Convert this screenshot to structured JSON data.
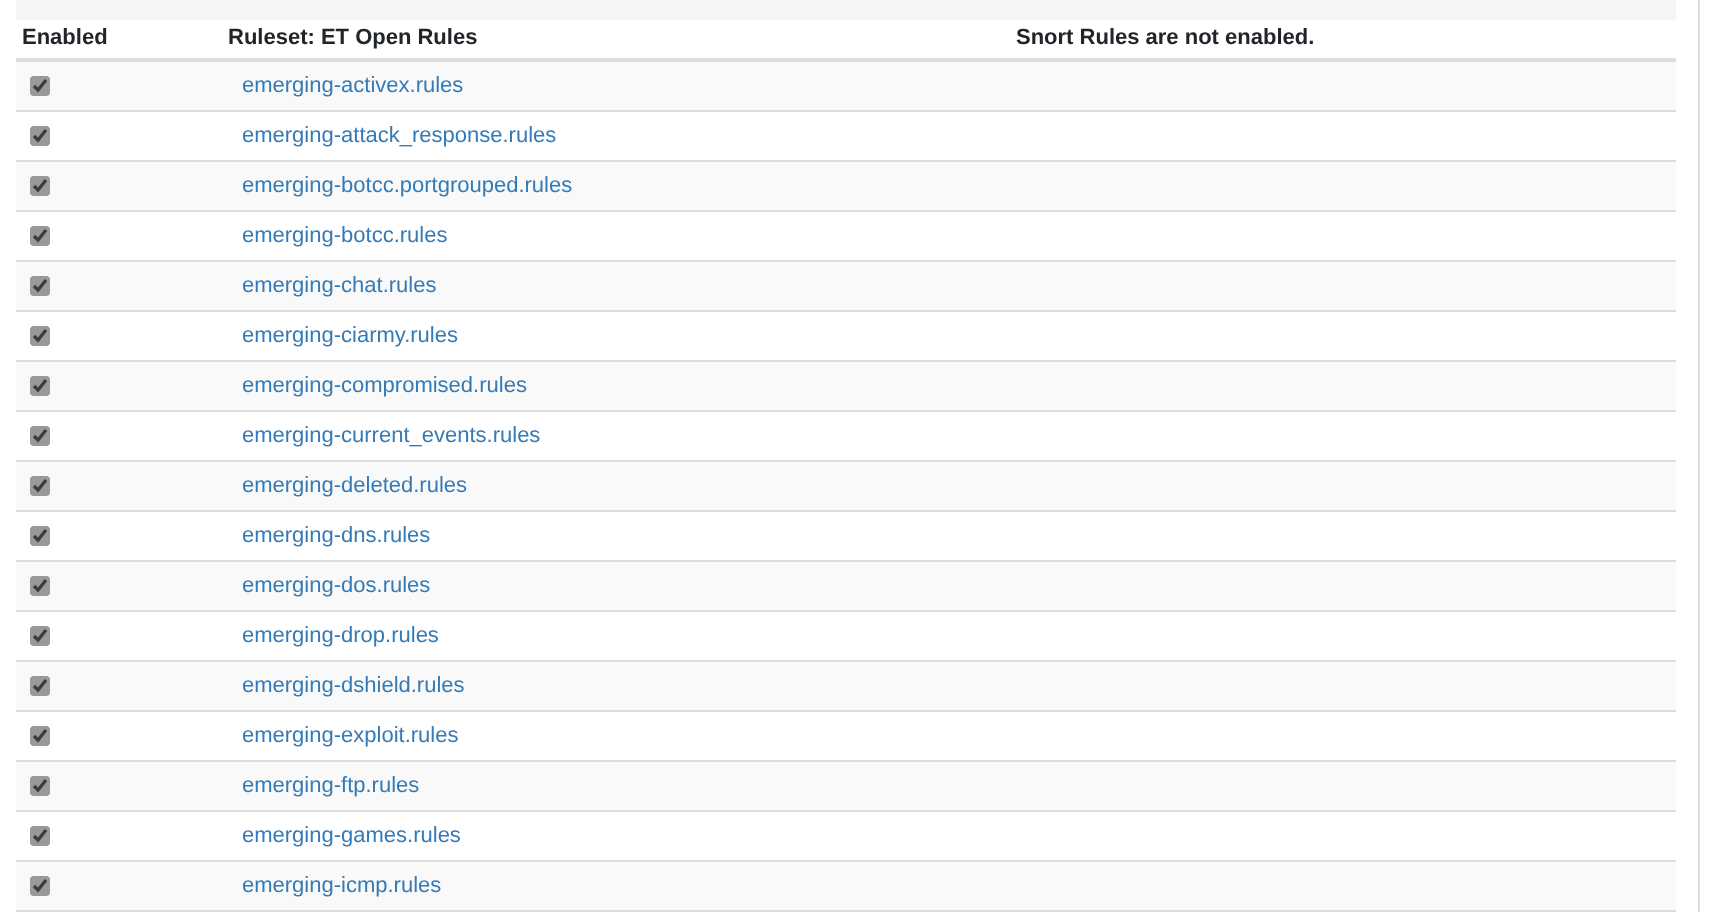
{
  "table": {
    "columns": [
      "Enabled",
      "Ruleset: ET Open Rules",
      "Snort Rules are not enabled."
    ],
    "rows": [
      {
        "checked": true,
        "name": "emerging-activex.rules"
      },
      {
        "checked": true,
        "name": "emerging-attack_response.rules"
      },
      {
        "checked": true,
        "name": "emerging-botcc.portgrouped.rules"
      },
      {
        "checked": true,
        "name": "emerging-botcc.rules"
      },
      {
        "checked": true,
        "name": "emerging-chat.rules"
      },
      {
        "checked": true,
        "name": "emerging-ciarmy.rules"
      },
      {
        "checked": true,
        "name": "emerging-compromised.rules"
      },
      {
        "checked": true,
        "name": "emerging-current_events.rules"
      },
      {
        "checked": true,
        "name": "emerging-deleted.rules"
      },
      {
        "checked": true,
        "name": "emerging-dns.rules"
      },
      {
        "checked": true,
        "name": "emerging-dos.rules"
      },
      {
        "checked": true,
        "name": "emerging-drop.rules"
      },
      {
        "checked": true,
        "name": "emerging-dshield.rules"
      },
      {
        "checked": true,
        "name": "emerging-exploit.rules"
      },
      {
        "checked": true,
        "name": "emerging-ftp.rules"
      },
      {
        "checked": true,
        "name": "emerging-games.rules"
      },
      {
        "checked": true,
        "name": "emerging-icmp.rules"
      }
    ]
  }
}
